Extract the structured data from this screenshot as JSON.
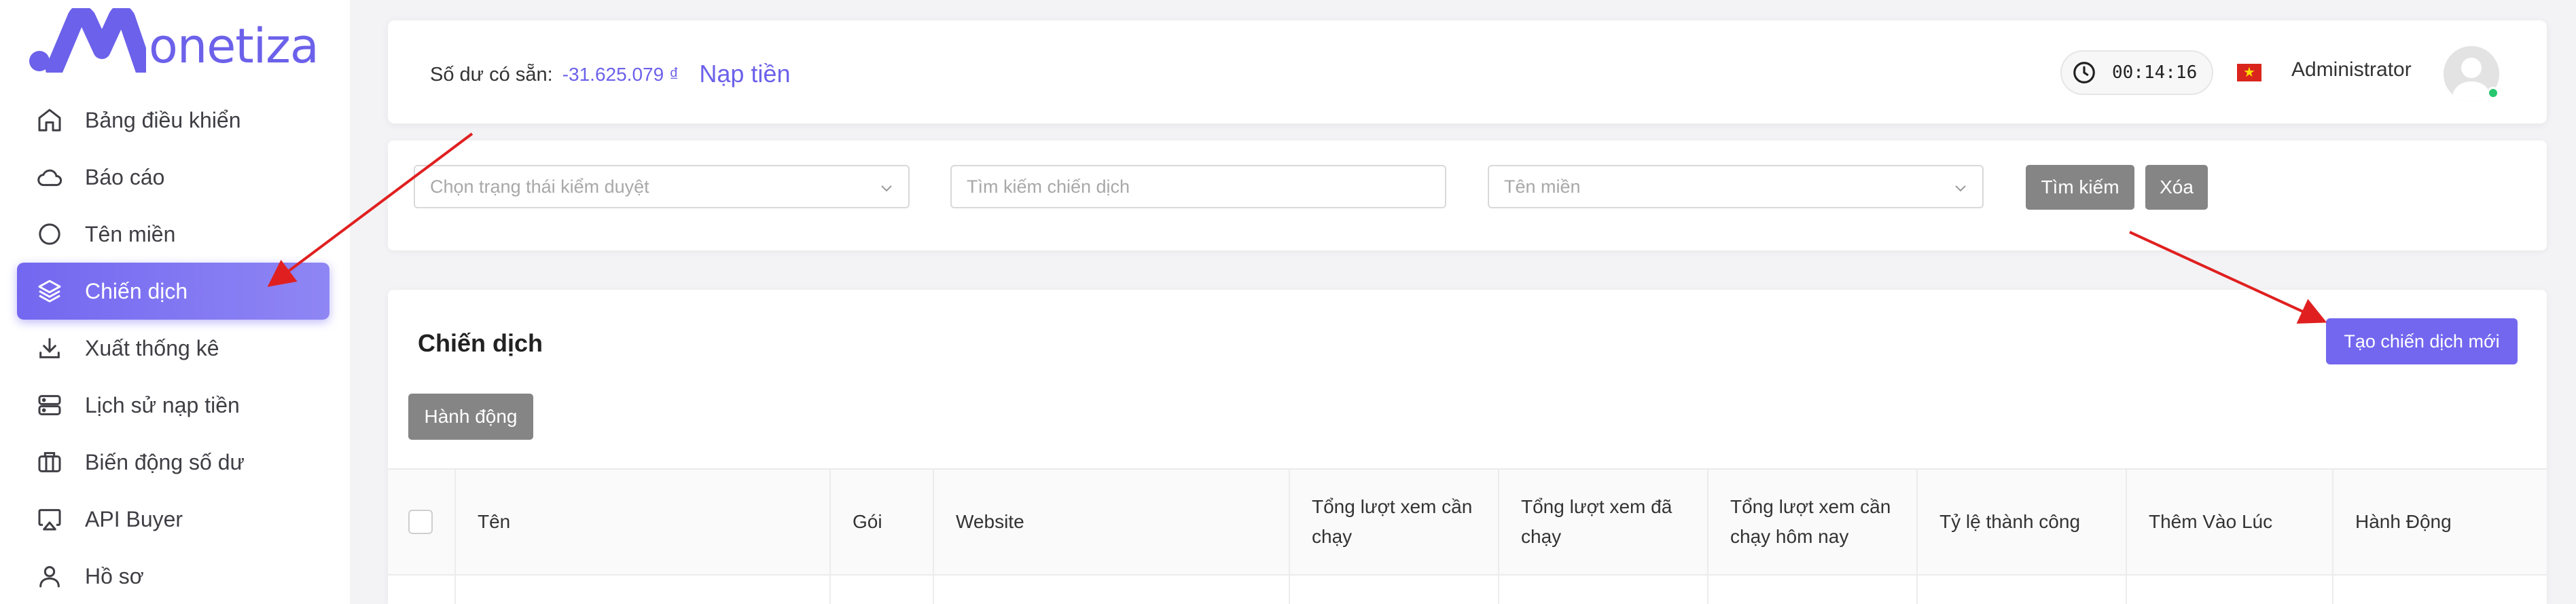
{
  "brand": {
    "logo_text": "onetiza",
    "color": "#6c61ea"
  },
  "sidebar": {
    "items": [
      {
        "label": "Bảng điều khiển",
        "icon": "home-icon"
      },
      {
        "label": "Báo cáo",
        "icon": "cloud-icon"
      },
      {
        "label": "Tên miền",
        "icon": "circle-icon"
      },
      {
        "label": "Chiến dịch",
        "icon": "layers-icon",
        "active": true
      },
      {
        "label": "Xuất thống kê",
        "icon": "download-icon"
      },
      {
        "label": "Lịch sử nạp tiền",
        "icon": "server-icon"
      },
      {
        "label": "Biến động số dư",
        "icon": "briefcase-icon"
      },
      {
        "label": "API Buyer",
        "icon": "airplay-icon"
      },
      {
        "label": "Hồ sơ",
        "icon": "user-icon"
      }
    ]
  },
  "header": {
    "balance_label": "Số dư có sẵn:",
    "balance_amount": "-31.625.079 ₫",
    "topup_label": "Nạp tiền",
    "timer": "00:14:16",
    "flag": "vietnam-flag-icon",
    "user_name": "Administrator"
  },
  "filters": {
    "status_placeholder": "Chọn trạng thái kiểm duyệt",
    "search_placeholder": "Tìm kiếm chiến dịch",
    "domain_placeholder": "Tên miền",
    "search_button": "Tìm kiếm",
    "clear_button": "Xóa"
  },
  "campaigns": {
    "title": "Chiến dịch",
    "create_button": "Tạo chiến dịch mới",
    "action_button": "Hành động",
    "columns": [
      "Tên",
      "Gói",
      "Website",
      "Tổng lượt xem cần chạy",
      "Tổng lượt xem đã chạy",
      "Tổng lượt xem cần chạy hôm nay",
      "Tỷ lệ thành công",
      "Thêm Vào Lúc",
      "Hành Động"
    ]
  },
  "colors": {
    "accent": "#7367f0",
    "gray_button": "#858585",
    "arrow": "#e02020",
    "status_online": "#28c76f"
  }
}
